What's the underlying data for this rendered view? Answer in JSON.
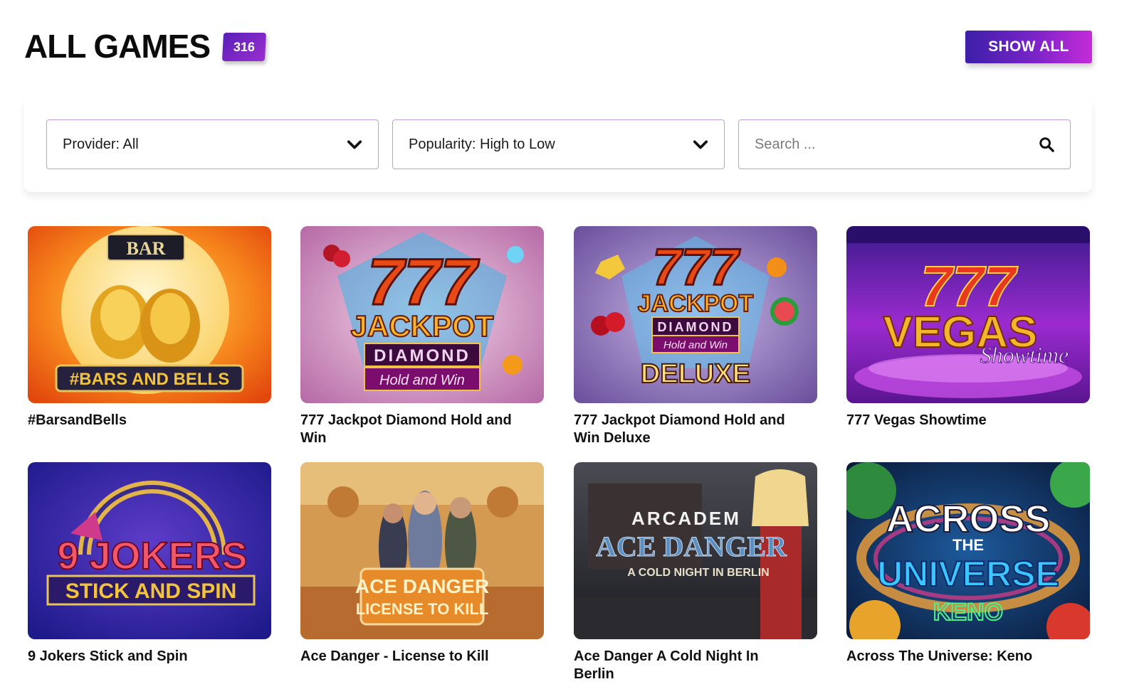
{
  "header": {
    "title": "ALL GAMES",
    "count": "316",
    "show_all_label": "SHOW ALL"
  },
  "filters": {
    "provider": "Provider: All",
    "sort": "Popularity: High to Low",
    "search_placeholder": "Search ..."
  },
  "games": [
    {
      "name": "#BarsandBells",
      "art": {
        "logo_top": "BAR",
        "logo_main": "#BARS AND BELLS"
      }
    },
    {
      "name": "777 Jackpot Diamond Hold and Win",
      "art": {
        "line1": "777",
        "line2": "JACKPOT",
        "line3": "DIAMOND",
        "line4": "Hold and Win"
      }
    },
    {
      "name": "777 Jackpot Diamond Hold and Win Deluxe",
      "art": {
        "line1": "777",
        "line2": "JACKPOT",
        "line3": "DIAMOND",
        "line4": "Hold and Win",
        "line5": "DELUXE"
      }
    },
    {
      "name": "777 Vegas Showtime",
      "art": {
        "line1": "777",
        "line2": "VEGAS",
        "line3": "Showtime"
      }
    },
    {
      "name": "9 Jokers Stick and Spin",
      "art": {
        "line1": "9 JOKERS",
        "line2": "STICK AND SPIN"
      }
    },
    {
      "name": "Ace Danger - License to Kill",
      "art": {
        "line1": "ACE DANGER",
        "line2": "LICENSE TO KILL"
      }
    },
    {
      "name": "Ace Danger A Cold Night In Berlin",
      "art": {
        "line1": "ARCADEM",
        "line2": "ACE DANGER",
        "line3": "A COLD NIGHT IN BERLIN"
      }
    },
    {
      "name": "Across The Universe: Keno",
      "art": {
        "line1": "ACROSS",
        "line2": "THE",
        "line3": "UNIVERSE",
        "line4": "KENO"
      }
    }
  ],
  "icons": {
    "provider_chevron": "chevron-down-icon",
    "sort_chevron": "chevron-down-icon",
    "search": "search-icon"
  },
  "colors": {
    "accent_purple": "#7a24c8",
    "filter_border": "#c69ad2"
  }
}
